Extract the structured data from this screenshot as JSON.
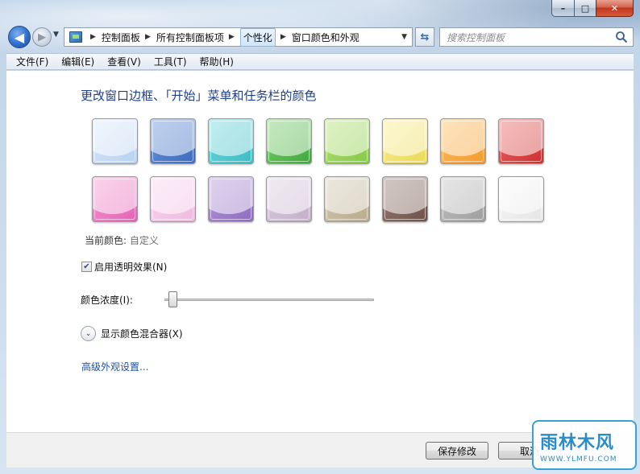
{
  "window": {
    "caption_buttons": {
      "minimize": "–",
      "maximize": "□",
      "close": "✕"
    }
  },
  "nav": {
    "back_icon": "◀",
    "forward_icon": "▶",
    "breadcrumb": [
      "控制面板",
      "所有控制面板项",
      "个性化",
      "窗口颜色和外观"
    ],
    "search_placeholder": "搜索控制面板"
  },
  "menu": [
    "文件(F)",
    "编辑(E)",
    "查看(V)",
    "工具(T)",
    "帮助(H)"
  ],
  "content": {
    "heading": "更改窗口边框、「开始」菜单和任务栏的颜色",
    "swatches": [
      {
        "color": "#dbe9fa",
        "dark": "#b7d1f0"
      },
      {
        "color": "#6a94d6",
        "dark": "#3c6bc0"
      },
      {
        "color": "#74d8dc",
        "dark": "#3bbcc4"
      },
      {
        "color": "#7dcf6e",
        "dark": "#3fa83c"
      },
      {
        "color": "#b7e37a",
        "dark": "#86c847"
      },
      {
        "color": "#f7ed8e",
        "dark": "#ecd95a"
      },
      {
        "color": "#fcc067",
        "dark": "#f59a2a"
      },
      {
        "color": "#e86a6a",
        "dark": "#cf2e2e"
      },
      {
        "color": "#f49bd1",
        "dark": "#e562b6"
      },
      {
        "color": "#f8d7ee",
        "dark": "#efb9df"
      },
      {
        "color": "#b59ad6",
        "dark": "#8d6bc0"
      },
      {
        "color": "#dccfe0",
        "dark": "#c3afc8"
      },
      {
        "color": "#d3cab4",
        "dark": "#b8ab8c"
      },
      {
        "color": "#9a7f78",
        "dark": "#6e5249"
      },
      {
        "color": "#c4c4c4",
        "dark": "#9e9e9e"
      },
      {
        "color": "#f8f8f8",
        "dark": "#e5e5e5"
      }
    ],
    "current_color_label": "当前颜色:",
    "current_color_value": "自定义",
    "transparency_label": "启用透明效果(N)",
    "transparency_checked": true,
    "intensity_label": "颜色浓度(I):",
    "intensity_value": 0.02,
    "mixer_label": "显示颜色混合器(X)",
    "advanced_link": "高级外观设置..."
  },
  "buttons": {
    "save": "保存修改",
    "cancel": "取消"
  },
  "watermark": {
    "main": "雨林木风",
    "sub": "WWW.YLMFU.COM"
  }
}
